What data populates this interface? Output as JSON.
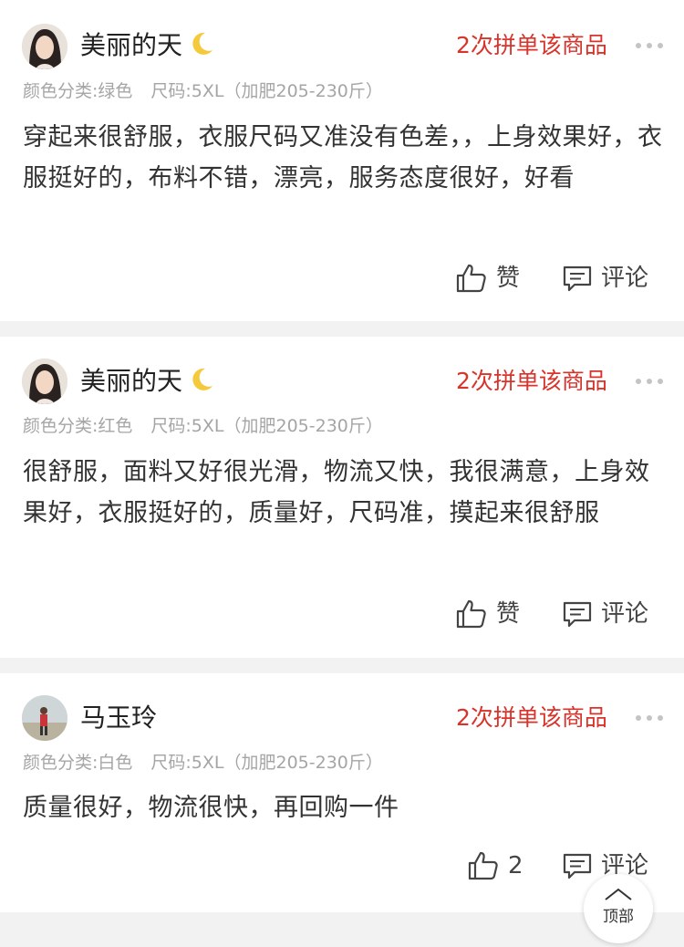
{
  "reviews": [
    {
      "username": "美丽的天",
      "badge": "2次拼单该商品",
      "meta_color": "颜色分类:绿色",
      "meta_size": "尺码:5XL（加肥205-230斤）",
      "content": "穿起来很舒服，衣服尺码又准没有色差，，上身效果好，衣服挺好的，布料不错，漂亮，服务态度很好，好看",
      "like_label": "赞",
      "comment_label": "评论"
    },
    {
      "username": "美丽的天",
      "badge": "2次拼单该商品",
      "meta_color": "颜色分类:红色",
      "meta_size": "尺码:5XL（加肥205-230斤）",
      "content": "很舒服，面料又好很光滑，物流又快，我很满意，上身效果好，衣服挺好的，质量好，尺码准，摸起来很舒服",
      "like_label": "赞",
      "comment_label": "评论"
    },
    {
      "username": "马玉玲",
      "badge": "2次拼单该商品",
      "meta_color": "颜色分类:白色",
      "meta_size": "尺码:5XL（加肥205-230斤）",
      "content": "质量很好，物流很快，再回购一件",
      "like_label": "2",
      "comment_label": "评论"
    }
  ],
  "top_button": {
    "label": "顶部"
  },
  "colors": {
    "badge": "#d8342b",
    "meta": "#a5a5a5",
    "background": "#f2f2f2"
  },
  "icons": [
    "moon-icon",
    "thumbs-up-icon",
    "comment-icon",
    "more-icon",
    "arrow-up-icon"
  ]
}
